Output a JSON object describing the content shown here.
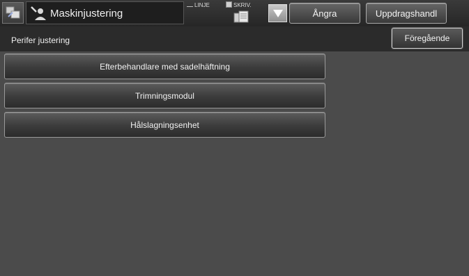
{
  "header": {
    "title": "Maskinjustering",
    "status_linje": "LINJE",
    "status_skriv": "SKRIV.",
    "undo_label": "Ångra",
    "jobs_label": "Uppdragshandl"
  },
  "subheader": {
    "title": "Perifer justering",
    "back_label": "Föregående"
  },
  "menu": {
    "items": [
      {
        "label": "Efterbehandlare med sadelhäftning"
      },
      {
        "label": "Trimningsmodul"
      },
      {
        "label": "Hålslagningsenhet"
      }
    ]
  },
  "colors": {
    "background": "#4b4b4b",
    "topbar": "#262626",
    "subheader": "#2b2b2b",
    "button_border": "#9a9a9a"
  },
  "icons": [
    "home-icon",
    "tool-person-icon",
    "printer-icon",
    "chevron-down-icon"
  ]
}
